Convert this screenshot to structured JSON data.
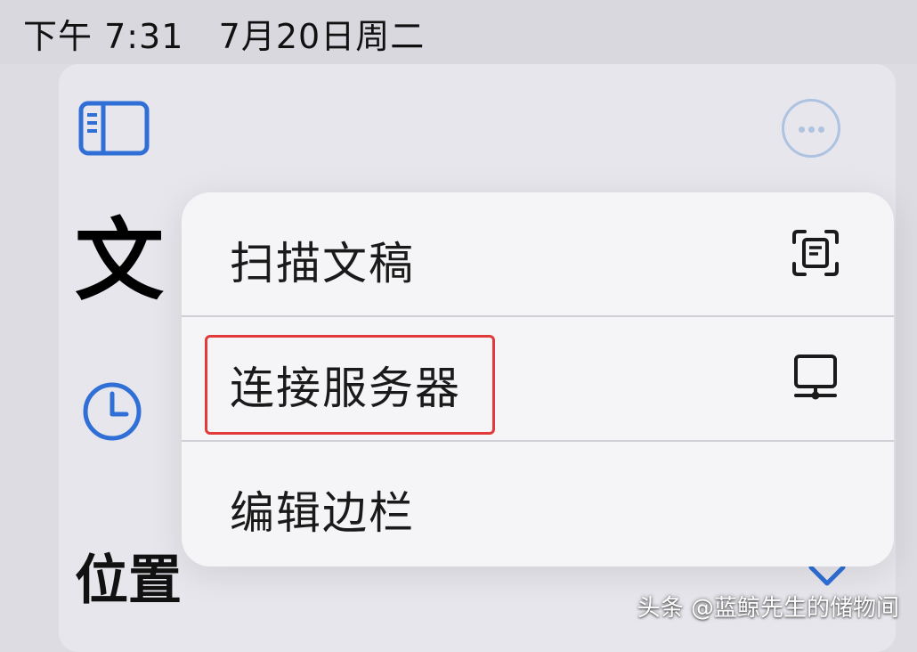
{
  "status_bar": {
    "time": "下午 7:31",
    "date": "7月20日周二"
  },
  "sidebar": {
    "title_partial": "文",
    "section_locations": "位置"
  },
  "menu": {
    "items": [
      {
        "label": "扫描文稿",
        "icon": "document-scanner-icon"
      },
      {
        "label": "连接服务器",
        "icon": "server-display-icon"
      },
      {
        "label": "编辑边栏",
        "icon": ""
      }
    ]
  },
  "icons": {
    "sidebar_toggle": "sidebar-toggle-icon",
    "more": "ellipsis-circle-icon",
    "recents": "clock-icon",
    "expand": "chevron-down-icon"
  },
  "colors": {
    "accent": "#2f6fd6",
    "highlight": "#e03a3a",
    "menu_bg": "#f5f5f7",
    "background": "#dcdce2"
  },
  "watermark": "头条 @蓝鲸先生的储物间"
}
